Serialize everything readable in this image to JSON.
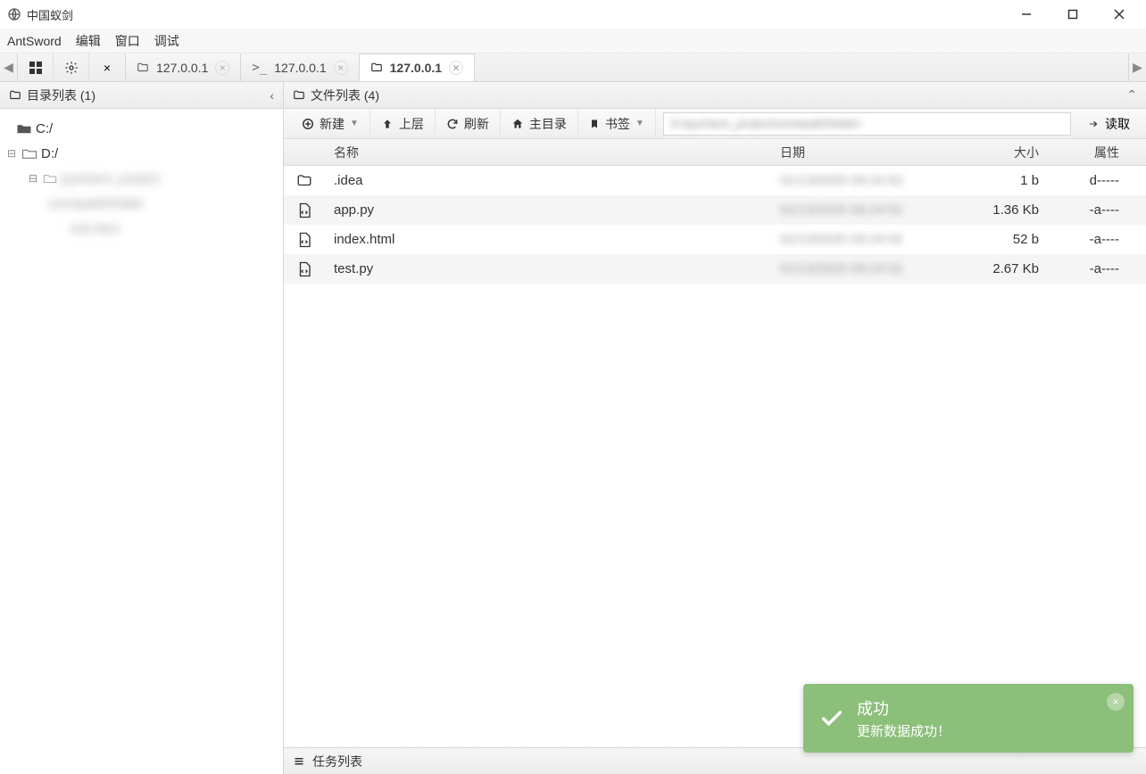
{
  "window": {
    "title": "中国蚁剑"
  },
  "menu": {
    "app": "AntSword",
    "edit": "编辑",
    "window": "窗口",
    "debug": "调试"
  },
  "tabs": {
    "items": [
      {
        "label": "127.0.0.1",
        "icon": "folder"
      },
      {
        "label": "127.0.0.1",
        "icon": "terminal"
      },
      {
        "label": "127.0.0.1",
        "icon": "folder",
        "active": true
      }
    ]
  },
  "leftPanel": {
    "title": "目录列表 (1)",
    "drives": {
      "c": "C:/",
      "d": "D:/"
    }
  },
  "rightPanel": {
    "title": "文件列表 (4)",
    "toolbar": {
      "new": "新建",
      "up": "上层",
      "refresh": "刷新",
      "home": "主目录",
      "bookmark": "书签",
      "read": "读取"
    },
    "columns": {
      "name": "名称",
      "date": "日期",
      "size": "大小",
      "attr": "属性"
    },
    "rows": [
      {
        "name": ".idea",
        "type": "folder",
        "date": "01/13/2025 09:24:52",
        "size": "1 b",
        "attr": "d-----"
      },
      {
        "name": "app.py",
        "type": "code",
        "date": "",
        "size": "1.36 Kb",
        "attr": "-a----"
      },
      {
        "name": "index.html",
        "type": "code",
        "date": "",
        "size": "52 b",
        "attr": "-a----"
      },
      {
        "name": "test.py",
        "type": "code",
        "date": "",
        "size": "2.67 Kb",
        "attr": "-a----"
      }
    ]
  },
  "taskList": {
    "title": "任务列表"
  },
  "toast": {
    "title": "成功",
    "message": "更新数据成功！"
  }
}
